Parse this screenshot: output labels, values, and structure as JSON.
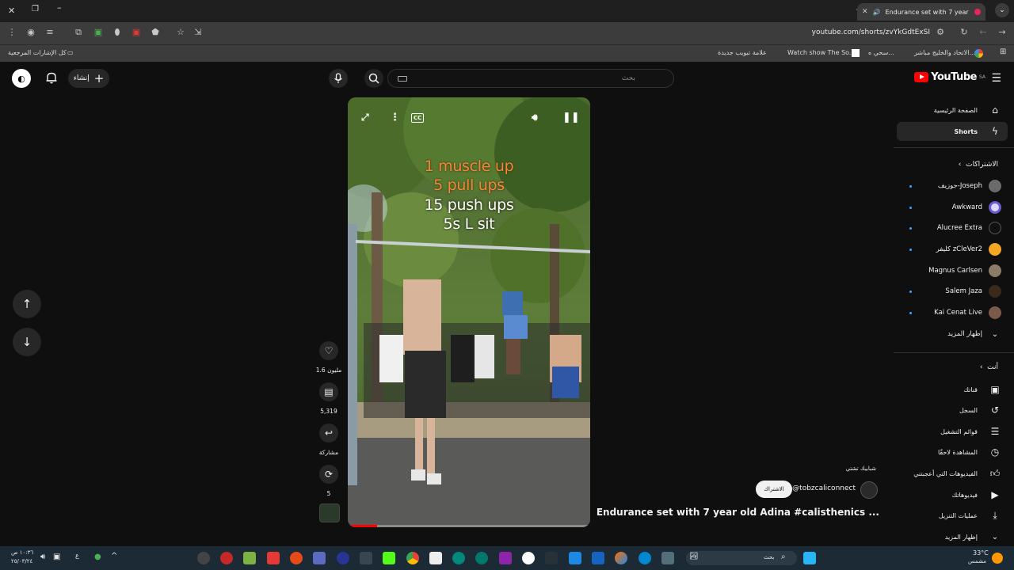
{
  "browser": {
    "tab_title": "Endurance set with 7 year o",
    "url": "youtube.com/shorts/zvYkGdtExSI",
    "bookmarks_all_label": "كل الإشارات المرجعية",
    "bookmarks": [
      "علامة تبويب جديدة",
      "Watch show The So...",
      "سحي ه...",
      "الاتحاد والخليج مباشر..."
    ]
  },
  "masthead": {
    "logo_word": "YouTube",
    "logo_region": "SA",
    "search_placeholder": "بحث",
    "create_label": "إنشاء"
  },
  "sidebar": {
    "main_items": [
      {
        "label": "الصفحة الرئيسية",
        "icon": "home-icon"
      },
      {
        "label": "Shorts",
        "icon": "shorts-icon",
        "active": true
      }
    ],
    "subscriptions_heading": "الاشتراكات",
    "subscriptions": [
      {
        "name": "جوزيف-Joseph",
        "color": "#6b6b6b"
      },
      {
        "name": "Awkward",
        "color": "#d9d9ff"
      },
      {
        "name": "Alucree Extra",
        "color": "#333333"
      },
      {
        "name": "كليفر zCleVer2",
        "color": "#f5a623"
      },
      {
        "name": "Magnus Carlsen",
        "color": "#8d7b6a"
      },
      {
        "name": "Salem Jaza",
        "color": "#3a2a1a"
      },
      {
        "name": "Kai Cenat Live",
        "color": "#7a5a4a"
      }
    ],
    "show_more_label": "إظهار المزيد",
    "you_heading": "أنت",
    "you_items": [
      {
        "label": "قناتك",
        "icon": "channel-icon"
      },
      {
        "label": "السجل",
        "icon": "history-icon"
      },
      {
        "label": "قوائم التشغيل",
        "icon": "playlists-icon"
      },
      {
        "label": "المشاهدة لاحقًا",
        "icon": "watch-later-icon"
      },
      {
        "label": "الفيديوهات التي أعجبتني",
        "icon": "liked-icon"
      },
      {
        "label": "فيديوهاتك",
        "icon": "your-videos-icon"
      },
      {
        "label": "عمليات التنزيل",
        "icon": "downloads-icon"
      },
      {
        "label": "إظهار المزيد",
        "icon": "chevron-down-icon"
      }
    ]
  },
  "short": {
    "overlay_lines": [
      "1 muscle up",
      "5 pull ups",
      "15 push ups",
      "5s L sit"
    ],
    "title": "Endurance set with 7 year old Adina #calisthenics ...",
    "channel_handle": "@tobzcaliconnect",
    "subscribe_label": "الاشتراك",
    "suggested_label": "شبابيك تشتي",
    "likes": "1.6 مليون",
    "comments": "5,319",
    "share_label": "مشاركة",
    "remix_count": "5",
    "progress": 0.12
  },
  "taskbar": {
    "search_placeholder": "بحث",
    "weather_temp": "33°C",
    "weather_desc": "مشمس",
    "time": "١٠:٣٦ ص",
    "date": "٢٥/٠٣/٢٤",
    "lang": "ع"
  },
  "colors": {
    "accent_red": "#ff0000",
    "link_blue": "#3ea6ff"
  }
}
